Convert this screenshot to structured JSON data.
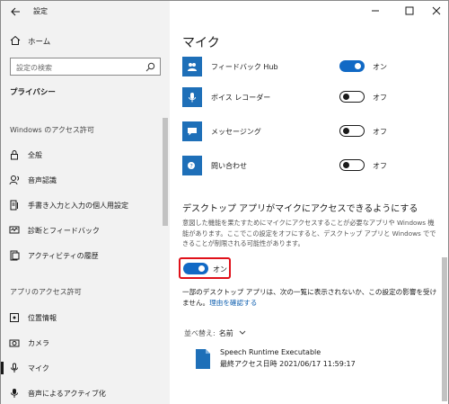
{
  "window": {
    "title": "設定"
  },
  "sidebar": {
    "home_label": "ホーム",
    "search_placeholder": "設定の検索",
    "section_title": "プライバシー",
    "group_windows": "Windows のアクセス許可",
    "windows_items": [
      {
        "label": "全般",
        "icon": "lock-icon"
      },
      {
        "label": "音声認識",
        "icon": "speech-icon"
      },
      {
        "label": "手書き入力と入力の個人用設定",
        "icon": "pen-icon"
      },
      {
        "label": "診断とフィードバック",
        "icon": "diagnostics-icon"
      },
      {
        "label": "アクティビティの履歴",
        "icon": "history-icon"
      }
    ],
    "group_apps": "アプリのアクセス許可",
    "app_items": [
      {
        "label": "位置情報",
        "icon": "location-icon"
      },
      {
        "label": "カメラ",
        "icon": "camera-icon"
      },
      {
        "label": "マイク",
        "icon": "microphone-icon",
        "active": true
      },
      {
        "label": "音声によるアクティブ化",
        "icon": "voice-activation-icon"
      }
    ]
  },
  "main": {
    "title": "マイク",
    "apps": [
      {
        "name": "フィードバック Hub",
        "state": "オン",
        "on": true
      },
      {
        "name": "ボイス レコーダー",
        "state": "オフ",
        "on": false
      },
      {
        "name": "メッセージング",
        "state": "オフ",
        "on": false
      },
      {
        "name": "問い合わせ",
        "state": "オフ",
        "on": false
      }
    ],
    "desktop_heading": "デスクトップ アプリがマイクにアクセスできるようにする",
    "desktop_desc": "意図した機能を果たすためにマイクにアクセスすることが必要なアプリや Windows 機能があります。ここでこの設定をオフにすると、デスクトップ アプリと Windows でできることが制限される可能性があります。",
    "desktop_toggle_label": "オン",
    "note_text": "一部のデスクトップ アプリは、次の一覧に表示されないか、この設定の影響を受けません。",
    "note_link": "理由を確認する",
    "sort_label": "並べ替え:",
    "sort_value": "名前",
    "exe_name": "Speech Runtime Executable",
    "exe_last_access": "最終アクセス日時 2021/06/17 11:59:17"
  },
  "colors": {
    "accent": "#1169c5",
    "highlight": "#e0111a",
    "tile": "#1e6fb8"
  }
}
